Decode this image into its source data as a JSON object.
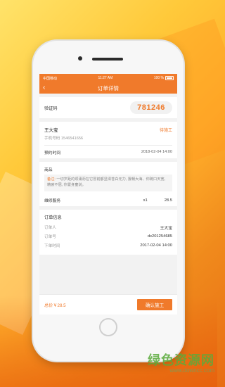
{
  "status_bar": {
    "carrier": "中国移动",
    "time": "11:27 AM",
    "battery": "100 %"
  },
  "nav": {
    "title": "订单详情"
  },
  "verification": {
    "label": "验证码",
    "code": "781246"
  },
  "customer": {
    "name": "王大宝",
    "status": "待施工",
    "phone": "手机号码  1546541656",
    "appointment_label": "预约时间",
    "appointment_time": "2018-02-04  14:00"
  },
  "goods": {
    "label": "商品",
    "note_label": "备注:",
    "note_text": "一切岁距的烦涌沥在它冒前都显得苍白无力, 置朝大海、你碗口天宽, 精疲不屈, 你置身童说。",
    "service_name": "维修服务",
    "quantity": "x1",
    "price": "28.5"
  },
  "order_info": {
    "title": "订单信息",
    "rows": [
      {
        "label": "订单人",
        "value": "王大宝"
      },
      {
        "label": "订单号",
        "value": "dx201254685"
      },
      {
        "label": "下单时间",
        "value": "2017-02-04  14:00"
      }
    ]
  },
  "footer": {
    "total": "总价￥28.5",
    "confirm_label": "确认施工"
  },
  "watermark": {
    "main": "绿色资源网",
    "sub": "www.downcc.com"
  },
  "colors": {
    "accent": "#f07a2b"
  }
}
